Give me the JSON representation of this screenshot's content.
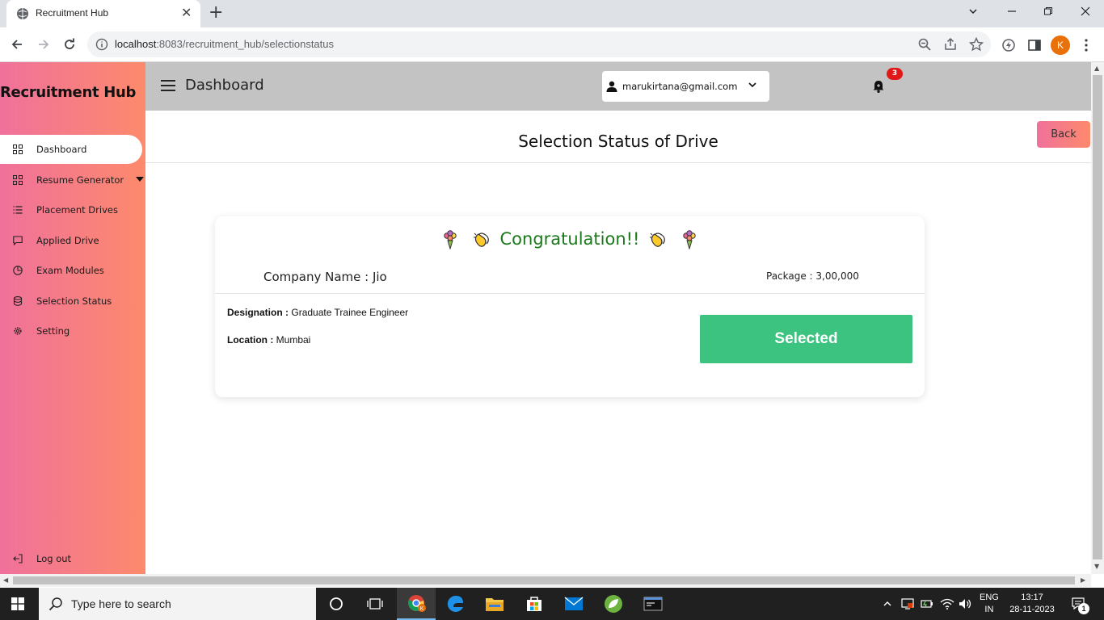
{
  "browser": {
    "tab_title": "Recruitment Hub",
    "tab_close": "✕",
    "new_tab": "+",
    "url_host": "localhost",
    "url_rest": ":8083/recruitment_hub/selectionstatus",
    "profile_initial": "K",
    "window_controls": [
      "minimize",
      "restore",
      "close"
    ]
  },
  "sidebar": {
    "brand": "Recruitment Hub",
    "items": [
      {
        "label": "Dashboard",
        "icon": "grid-icon",
        "active": true
      },
      {
        "label": "Resume Generator",
        "icon": "grid-icon",
        "has_submenu": true
      },
      {
        "label": "Placement Drives",
        "icon": "list-icon"
      },
      {
        "label": "Applied Drive",
        "icon": "chat-icon"
      },
      {
        "label": "Exam Modules",
        "icon": "pie-icon"
      },
      {
        "label": "Selection Status",
        "icon": "database-icon"
      },
      {
        "label": "Setting",
        "icon": "gear-icon"
      }
    ],
    "logout": "Log out"
  },
  "header": {
    "title": "Dashboard",
    "user_email": "marukirtana@gmail.com",
    "notification_count": "3"
  },
  "page": {
    "title": "Selection Status of Drive",
    "back_label": "Back"
  },
  "card": {
    "congrats": "Congratulation!!",
    "company": "Company Name : Jio",
    "package": "Package : 3,00,000",
    "designation_label": "Designation :",
    "designation_value": "Graduate Trainee Engineer",
    "location_label": "Location :",
    "location_value": "Mumbai",
    "status": "Selected"
  },
  "taskbar": {
    "search_placeholder": "Type here to search",
    "lang_line1": "ENG",
    "lang_line2": "IN",
    "time": "13:17",
    "date": "28-11-2023",
    "notification_count": "1"
  },
  "colors": {
    "sidebar_gradient_start": "#f0719b",
    "sidebar_gradient_end": "#fd8a6c",
    "topbar": "#c3c3c3",
    "success": "#3bc37f",
    "congrats_text": "#1a7a1a",
    "badge": "#e21818"
  }
}
